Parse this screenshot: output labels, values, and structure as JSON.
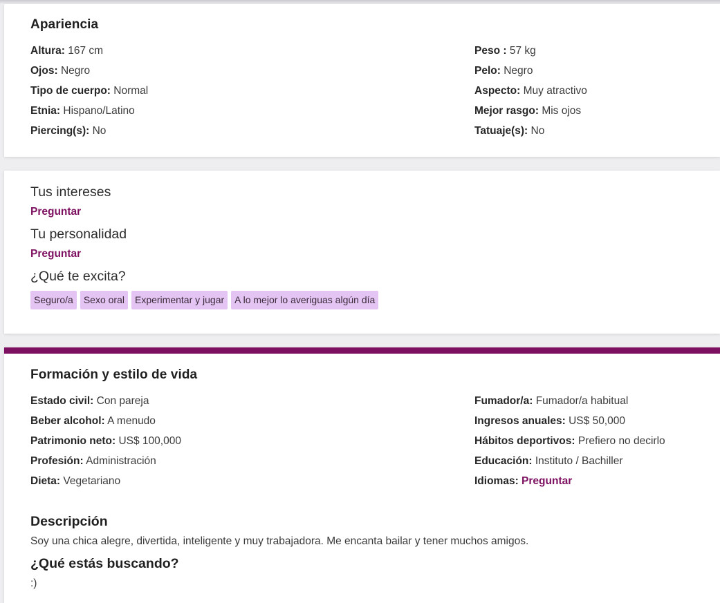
{
  "appearance": {
    "title": "Apariencia",
    "left": [
      {
        "label": "Altura:",
        "value": "167 cm"
      },
      {
        "label": "Ojos:",
        "value": "Negro"
      },
      {
        "label": "Tipo de cuerpo:",
        "value": "Normal"
      },
      {
        "label": "Etnia:",
        "value": "Hispano/Latino"
      },
      {
        "label": "Piercing(s):",
        "value": "No"
      }
    ],
    "right": [
      {
        "label": "Peso :",
        "value": "57 kg"
      },
      {
        "label": "Pelo:",
        "value": "Negro"
      },
      {
        "label": "Aspecto:",
        "value": "Muy atractivo"
      },
      {
        "label": "Mejor rasgo:",
        "value": "Mis ojos"
      },
      {
        "label": "Tatuaje(s):",
        "value": "No"
      }
    ]
  },
  "interests": {
    "interests_title": "Tus intereses",
    "interests_ask": "Preguntar",
    "personality_title": "Tu personalidad",
    "personality_ask": "Preguntar",
    "turnons_title": "¿Qué te excita?",
    "tags": [
      "Seguro/a",
      "Sexo oral",
      "Experimentar y jugar",
      "A lo mejor lo averiguas algún día"
    ]
  },
  "lifestyle": {
    "title": "Formación y estilo de vida",
    "left": [
      {
        "label": "Estado civil:",
        "value": "Con pareja"
      },
      {
        "label": "Beber alcohol:",
        "value": "A menudo"
      },
      {
        "label": "Patrimonio neto:",
        "value": "US$ 100,000"
      },
      {
        "label": "Profesión:",
        "value": "Administración"
      },
      {
        "label": "Dieta:",
        "value": "Vegetariano"
      }
    ],
    "right": [
      {
        "label": "Fumador/a:",
        "value": "Fumador/a habitual"
      },
      {
        "label": "Ingresos anuales:",
        "value": "US$ 50,000"
      },
      {
        "label": "Hábitos deportivos:",
        "value": "Prefiero no decirlo"
      },
      {
        "label": "Educación:",
        "value": "Instituto / Bachiller"
      },
      {
        "label": "Idiomas:",
        "value": "Preguntar"
      }
    ],
    "description_title": "Descripción",
    "description_text": "Soy una chica alegre, divertida, inteligente y muy trabajadora. Me encanta bailar y tener muchos amigos.",
    "seeking_title": "¿Qué estás buscando?",
    "seeking_text": ":)"
  },
  "colors": {
    "accent": "#7d1060",
    "tag_bg": "#e4c4f3"
  }
}
